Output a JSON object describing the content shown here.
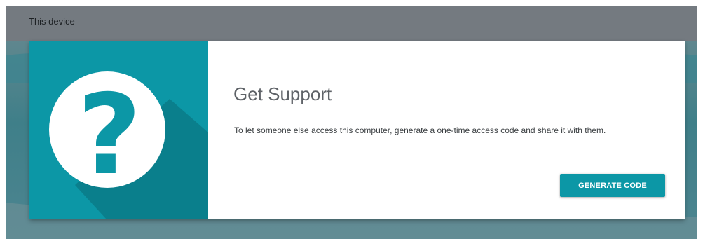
{
  "header": {
    "title": "This device"
  },
  "card": {
    "icon": "help-question-icon",
    "title": "Get Support",
    "description": "To let someone else access this computer, generate a one-time access code and share it with them.",
    "generate_label": "GENERATE CODE"
  },
  "colors": {
    "accent": "#0c97a6",
    "header_bar": "#747a80",
    "background_teal": "#4e8892"
  }
}
